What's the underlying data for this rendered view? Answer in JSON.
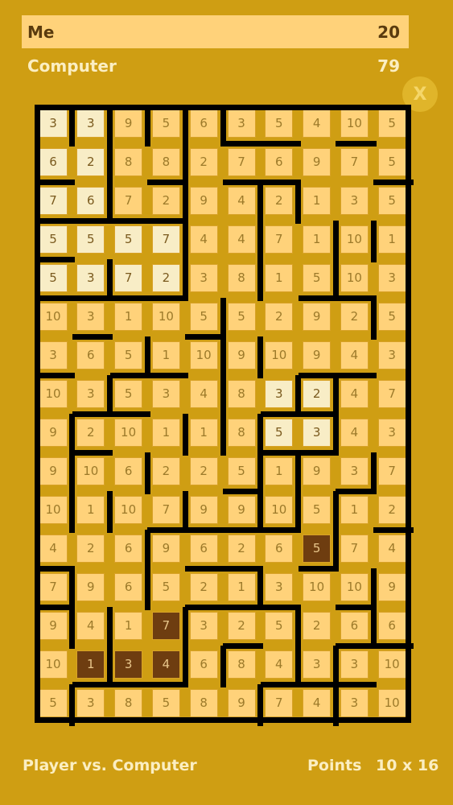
{
  "scores": {
    "me": {
      "label": "Me",
      "value": "20"
    },
    "computer": {
      "label": "Computer",
      "value": "79"
    }
  },
  "close_label": "X",
  "footer": {
    "mode": "Player vs. Computer",
    "points_label": "Points",
    "size": "10 x 16"
  },
  "colors": {
    "background": "#cf9e13",
    "cell": "#ffd27a",
    "player_captured": "#f8edc6",
    "computer_captured": "#6e3d10"
  },
  "board": {
    "columns": 10,
    "rows": 16,
    "values": [
      [
        3,
        3,
        9,
        5,
        6,
        3,
        5,
        4,
        10,
        5
      ],
      [
        6,
        2,
        8,
        8,
        2,
        7,
        6,
        9,
        7,
        5
      ],
      [
        7,
        6,
        7,
        2,
        9,
        4,
        2,
        1,
        3,
        5
      ],
      [
        5,
        5,
        5,
        7,
        4,
        4,
        7,
        1,
        10,
        1
      ],
      [
        5,
        3,
        7,
        2,
        3,
        8,
        1,
        5,
        10,
        3
      ],
      [
        10,
        3,
        1,
        10,
        5,
        5,
        2,
        9,
        2,
        5
      ],
      [
        3,
        6,
        5,
        1,
        10,
        9,
        10,
        9,
        4,
        3
      ],
      [
        10,
        3,
        5,
        3,
        4,
        8,
        3,
        2,
        4,
        7
      ],
      [
        9,
        2,
        10,
        1,
        1,
        8,
        5,
        3,
        4,
        3
      ],
      [
        9,
        10,
        6,
        2,
        2,
        5,
        1,
        9,
        3,
        7
      ],
      [
        10,
        1,
        10,
        7,
        9,
        9,
        10,
        5,
        1,
        2
      ],
      [
        4,
        2,
        6,
        9,
        6,
        2,
        6,
        5,
        7,
        4
      ],
      [
        7,
        9,
        6,
        5,
        2,
        1,
        3,
        10,
        10,
        9
      ],
      [
        9,
        4,
        1,
        7,
        3,
        2,
        5,
        2,
        6,
        6
      ],
      [
        10,
        1,
        3,
        4,
        6,
        8,
        4,
        3,
        3,
        10
      ],
      [
        5,
        3,
        8,
        5,
        8,
        9,
        7,
        4,
        3,
        10
      ]
    ],
    "light_cells": [
      [
        0,
        0
      ],
      [
        0,
        1
      ],
      [
        1,
        0
      ],
      [
        1,
        1
      ],
      [
        2,
        0
      ],
      [
        2,
        1
      ],
      [
        3,
        0
      ],
      [
        3,
        1
      ],
      [
        3,
        2
      ],
      [
        3,
        3
      ],
      [
        4,
        0
      ],
      [
        4,
        1
      ],
      [
        4,
        2
      ],
      [
        4,
        3
      ],
      [
        7,
        6
      ],
      [
        7,
        7
      ],
      [
        8,
        6
      ],
      [
        8,
        7
      ]
    ],
    "dark_cells": [
      [
        11,
        7
      ],
      [
        13,
        3
      ],
      [
        14,
        1
      ],
      [
        14,
        2
      ],
      [
        14,
        3
      ]
    ]
  }
}
